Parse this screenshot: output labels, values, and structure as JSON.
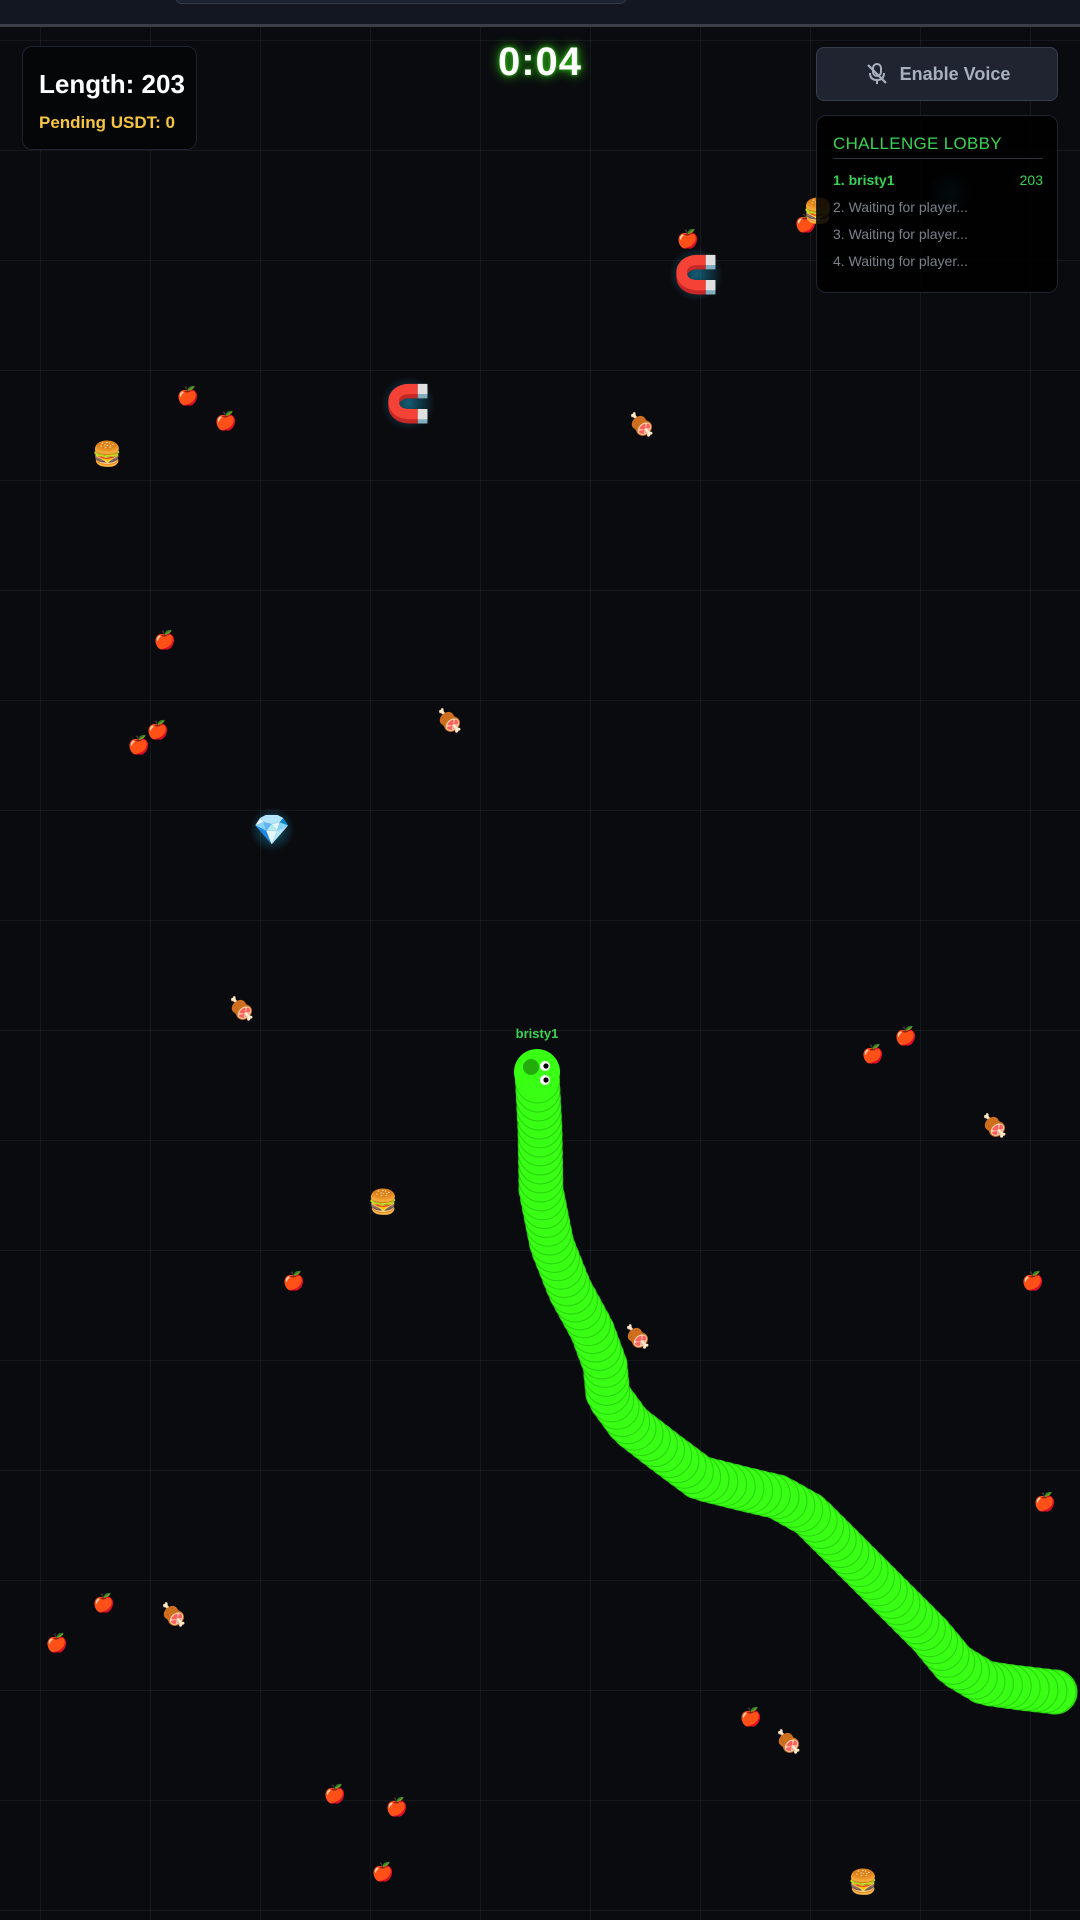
{
  "hud": {
    "length_text": "Length: 203",
    "pending_text": "Pending USDT: 0",
    "timer": "0:04"
  },
  "voice": {
    "label": "Enable Voice",
    "icon": "mic-off-icon"
  },
  "lobby": {
    "title": "CHALLENGE LOBBY",
    "players": [
      {
        "rank_name": "1. bristy1",
        "score": "203",
        "active": true
      },
      {
        "rank_name": "2. Waiting for player...",
        "score": "",
        "active": false
      },
      {
        "rank_name": "3. Waiting for player...",
        "score": "",
        "active": false
      },
      {
        "rank_name": "4. Waiting for player...",
        "score": "",
        "active": false
      }
    ]
  },
  "player": {
    "name": "bristy1",
    "color": "#39ff14"
  },
  "colors": {
    "accent_green": "#39d353",
    "pending_yellow": "#f5c542",
    "background": "#0a0b0f"
  },
  "items": {
    "apple": "apple-icon",
    "meat": "meat-icon",
    "burger": "burger-icon",
    "magnet": "magnet-icon",
    "diamond": "diamond-icon"
  }
}
